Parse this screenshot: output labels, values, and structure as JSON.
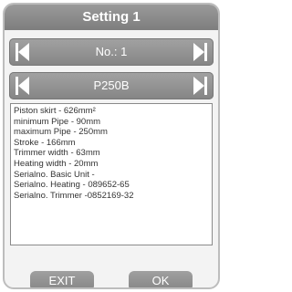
{
  "header": {
    "title": "Setting 1"
  },
  "selectors": [
    {
      "value": "No.: 1"
    },
    {
      "value": "P250B"
    }
  ],
  "info_lines": [
    "Piston skirt - 626mm²",
    "minimum Pipe - 90mm",
    "maximum Pipe - 250mm",
    "Stroke - 166mm",
    "Trimmer width - 63mm",
    "Heating width - 20mm",
    "Serialno. Basic Unit -",
    "Serialno. Heating - 089652-65",
    "Serialno. Trimmer -0852169-32"
  ],
  "buttons": {
    "exit_label": "EXIT",
    "ok_label": "OK"
  },
  "colors": {
    "bar": "#8a8a8a",
    "text_light": "#ffffff",
    "panel_text": "#333333"
  },
  "icons": {
    "left": "arrow-left-icon",
    "right": "arrow-right-icon"
  }
}
